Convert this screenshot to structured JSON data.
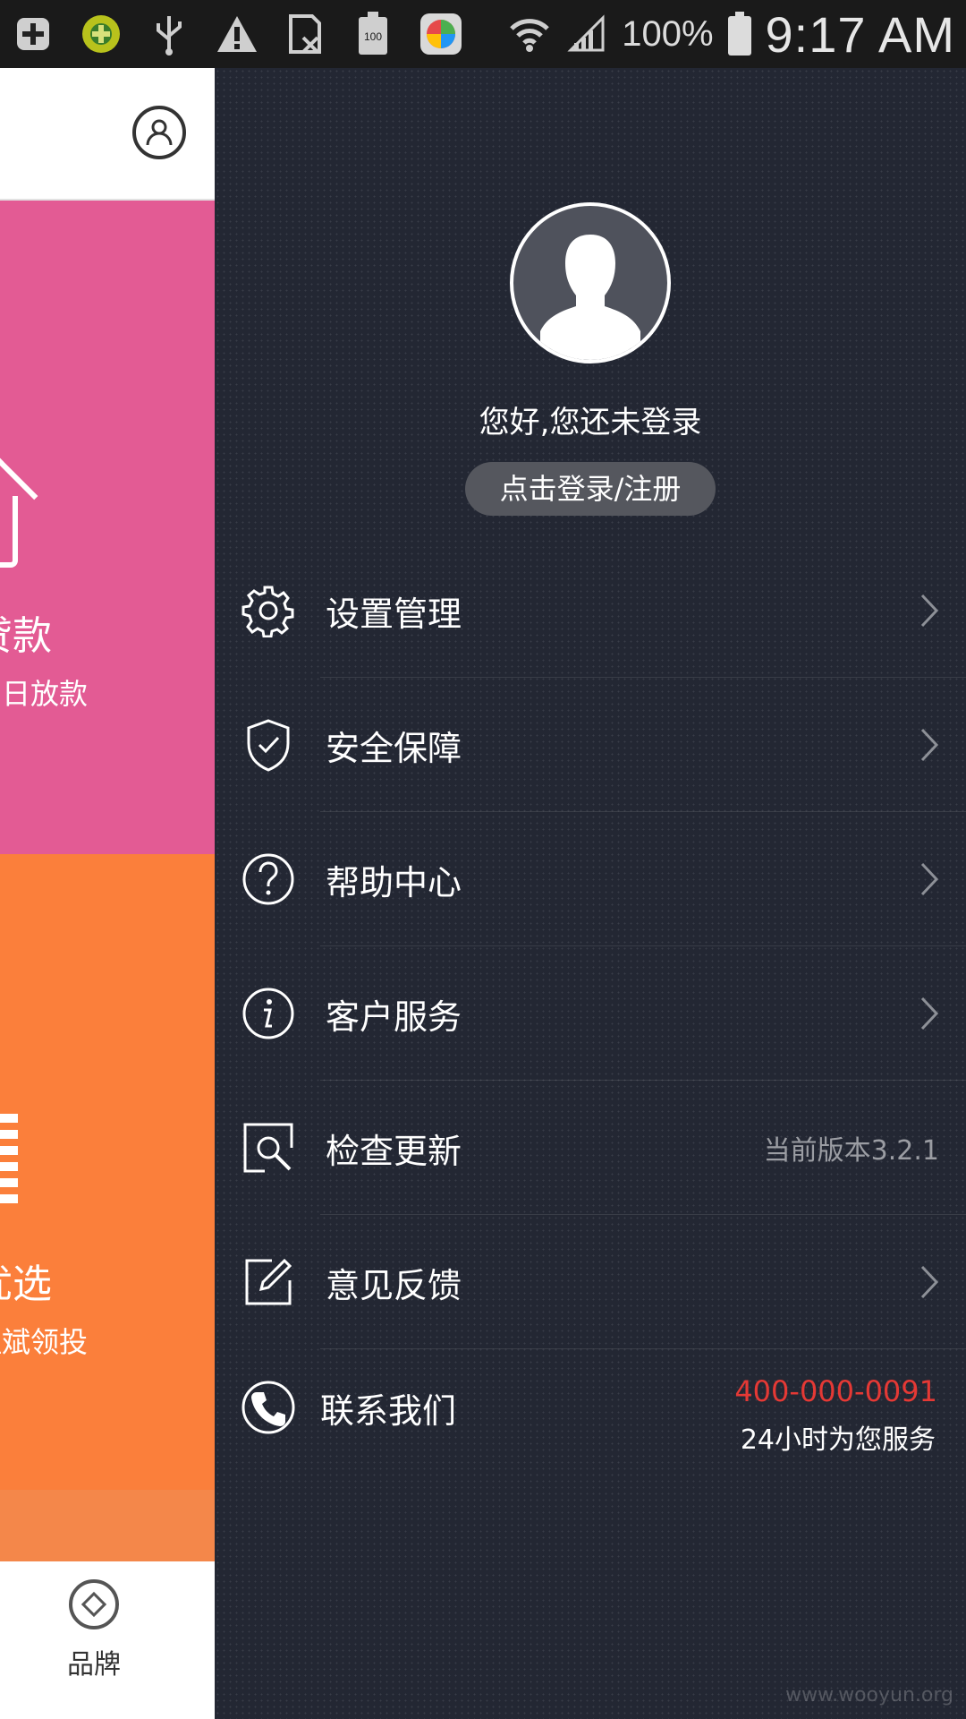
{
  "status_bar": {
    "battery_percent": "100%",
    "battery_badge": "100",
    "time": "9:17 AM",
    "icons": [
      "plus-icon",
      "clover-icon",
      "usb-icon",
      "warning-icon",
      "no-sim-icon",
      "battery-small-icon",
      "app-icon",
      "wifi-icon",
      "signal-icon",
      "battery-icon"
    ]
  },
  "background_app": {
    "card1_title": "贷款",
    "card1_sub": "当日放款",
    "card2_title": "优选",
    "card2_sub": "理斌领投",
    "bottom_tab_label": "品牌",
    "colors": {
      "pink": "#e35b94",
      "orange": "#fb7f3b"
    }
  },
  "drawer": {
    "greeting": "您好,您还未登录",
    "login_button": "点击登录/注册",
    "menu": [
      {
        "icon": "gear-icon",
        "label": "设置管理"
      },
      {
        "icon": "shield-check-icon",
        "label": "安全保障"
      },
      {
        "icon": "help-circle-icon",
        "label": "帮助中心"
      },
      {
        "icon": "info-circle-icon",
        "label": "客户服务"
      },
      {
        "icon": "search-update-icon",
        "label": "检查更新",
        "value": "当前版本3.2.1"
      },
      {
        "icon": "edit-icon",
        "label": "意见反馈"
      },
      {
        "icon": "phone-icon",
        "label": "联系我们",
        "phone": "400-000-0091",
        "sub": "24小时为您服务"
      }
    ],
    "watermark": "www.wooyun.org",
    "accent_color": "#e53935"
  }
}
